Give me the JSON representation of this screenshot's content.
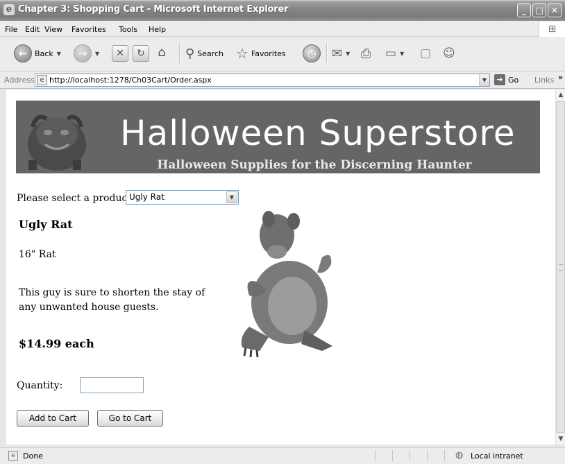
{
  "window": {
    "title": "Chapter 3: Shopping Cart - Microsoft Internet Explorer"
  },
  "menu": [
    "File",
    "Edit",
    "View",
    "Favorites",
    "Tools",
    "Help"
  ],
  "toolbar": {
    "back": "Back",
    "search": "Search",
    "favorites": "Favorites"
  },
  "address": {
    "label": "Address",
    "url": "http://localhost:1278/Ch03Cart/Order.aspx",
    "go": "Go",
    "links": "Links"
  },
  "banner": {
    "title": "Halloween Superstore",
    "subtitle": "Halloween Supplies for the Discerning Haunter"
  },
  "form": {
    "product_label": "Please select a product:",
    "selected_product": "Ugly Rat",
    "quantity_label": "Quantity:",
    "quantity_value": "",
    "add_button": "Add to Cart",
    "cart_button": "Go to Cart"
  },
  "product": {
    "name": "Ugly Rat",
    "short_description": "16\" Rat",
    "long_description": "This guy is sure to shorten the stay of any unwanted house guests.",
    "price": "$14.99 each"
  },
  "status": {
    "text": "Done",
    "zone": "Local intranet"
  }
}
